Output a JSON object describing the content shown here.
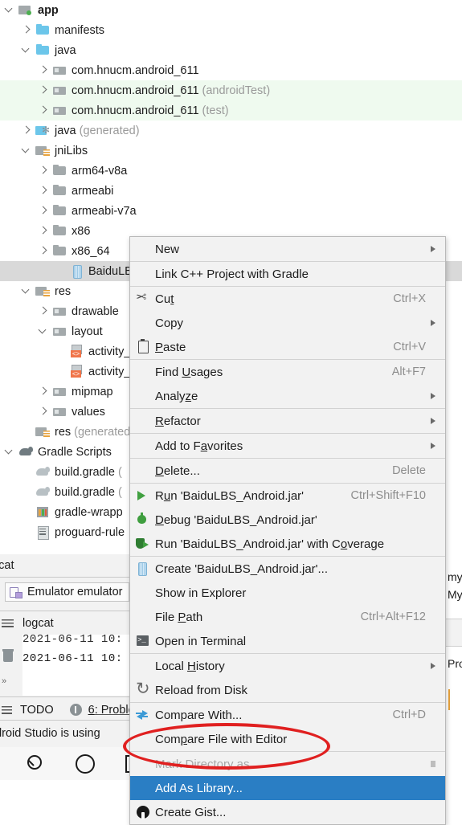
{
  "project_tree": {
    "rows": [
      {
        "indent": 0,
        "twisty": "down",
        "icon": "module-icon",
        "label": "app",
        "dim": "",
        "bold": true,
        "highlight": "none"
      },
      {
        "indent": 1,
        "twisty": "right",
        "icon": "folder-blue-icon",
        "label": "manifests",
        "dim": "",
        "bold": false,
        "highlight": "none"
      },
      {
        "indent": 1,
        "twisty": "down",
        "icon": "folder-blue-icon",
        "label": "java",
        "dim": "",
        "bold": false,
        "highlight": "none"
      },
      {
        "indent": 2,
        "twisty": "right",
        "icon": "package-icon",
        "label": "com.hnucm.android_611",
        "dim": "",
        "bold": false,
        "highlight": "none"
      },
      {
        "indent": 2,
        "twisty": "right",
        "icon": "package-icon",
        "label": "com.hnucm.android_611",
        "dim": "(androidTest)",
        "bold": false,
        "highlight": "green"
      },
      {
        "indent": 2,
        "twisty": "right",
        "icon": "package-icon",
        "label": "com.hnucm.android_611",
        "dim": "(test)",
        "bold": false,
        "highlight": "green"
      },
      {
        "indent": 1,
        "twisty": "right",
        "icon": "generated-java-icon",
        "label": "java",
        "dim": "(generated)",
        "bold": false,
        "highlight": "none"
      },
      {
        "indent": 1,
        "twisty": "down",
        "icon": "res-folder-icon",
        "label": "jniLibs",
        "dim": "",
        "bold": false,
        "highlight": "none"
      },
      {
        "indent": 2,
        "twisty": "right",
        "icon": "folder-gray-icon",
        "label": "arm64-v8a",
        "dim": "",
        "bold": false,
        "highlight": "none"
      },
      {
        "indent": 2,
        "twisty": "right",
        "icon": "folder-gray-icon",
        "label": "armeabi",
        "dim": "",
        "bold": false,
        "highlight": "none"
      },
      {
        "indent": 2,
        "twisty": "right",
        "icon": "folder-gray-icon",
        "label": "armeabi-v7a",
        "dim": "",
        "bold": false,
        "highlight": "none"
      },
      {
        "indent": 2,
        "twisty": "right",
        "icon": "folder-gray-icon",
        "label": "x86",
        "dim": "",
        "bold": false,
        "highlight": "none"
      },
      {
        "indent": 2,
        "twisty": "right",
        "icon": "folder-gray-icon",
        "label": "x86_64",
        "dim": "",
        "bold": false,
        "highlight": "none"
      },
      {
        "indent": 3,
        "twisty": "none",
        "icon": "jar-file-icon",
        "label": "BaiduLBS_A",
        "dim": "",
        "bold": false,
        "highlight": "selected"
      },
      {
        "indent": 1,
        "twisty": "down",
        "icon": "res-folder-icon",
        "label": "res",
        "dim": "",
        "bold": false,
        "highlight": "none"
      },
      {
        "indent": 2,
        "twisty": "right",
        "icon": "package-icon",
        "label": "drawable",
        "dim": "",
        "bold": false,
        "highlight": "none"
      },
      {
        "indent": 2,
        "twisty": "down",
        "icon": "package-icon",
        "label": "layout",
        "dim": "",
        "bold": false,
        "highlight": "none"
      },
      {
        "indent": 3,
        "twisty": "none",
        "icon": "layout-xml-icon",
        "label": "activity_",
        "dim": "",
        "bold": false,
        "highlight": "none"
      },
      {
        "indent": 3,
        "twisty": "none",
        "icon": "layout-xml-icon",
        "label": "activity_",
        "dim": "",
        "bold": false,
        "highlight": "none"
      },
      {
        "indent": 2,
        "twisty": "right",
        "icon": "package-icon",
        "label": "mipmap",
        "dim": "",
        "bold": false,
        "highlight": "none"
      },
      {
        "indent": 2,
        "twisty": "right",
        "icon": "package-icon",
        "label": "values",
        "dim": "",
        "bold": false,
        "highlight": "none"
      },
      {
        "indent": 1,
        "twisty": "none",
        "icon": "res-folder-icon",
        "label": "res",
        "dim": "(generated",
        "bold": false,
        "highlight": "none"
      },
      {
        "indent": 0,
        "twisty": "down",
        "icon": "gradle-icon",
        "label": "Gradle Scripts",
        "dim": "",
        "bold": false,
        "highlight": "none"
      },
      {
        "indent": 1,
        "twisty": "none",
        "icon": "gradle-light-icon",
        "label": "build.gradle",
        "dim": "(",
        "bold": false,
        "highlight": "none"
      },
      {
        "indent": 1,
        "twisty": "none",
        "icon": "gradle-light-icon",
        "label": "build.gradle",
        "dim": "(",
        "bold": false,
        "highlight": "none"
      },
      {
        "indent": 1,
        "twisty": "none",
        "icon": "properties-icon",
        "label": "gradle-wrapp",
        "dim": "",
        "bold": false,
        "highlight": "none"
      },
      {
        "indent": 1,
        "twisty": "none",
        "icon": "doc-file-icon",
        "label": "proguard-rule",
        "dim": "",
        "bold": false,
        "highlight": "none"
      }
    ]
  },
  "bottom": {
    "logcat_tab_label": "ogcat",
    "device_chip_label": "Emulator emulator",
    "logcat_sub_label": "logcat",
    "console_lines": [
      "2021-06-11 10:",
      "2021-06-11 10:"
    ],
    "gutter_chevrons": "»",
    "todo_label": "TODO",
    "problems_number": "6",
    "problems_label": ": Problem",
    "hint_text": "ndroid Studio is using"
  },
  "right_sliver": {
    "line1": "my",
    "line2": "My",
    "line3": "Pro"
  },
  "context_menu": {
    "items": [
      {
        "type": "item",
        "label": "New",
        "accel": "",
        "icon": "",
        "arrow": true,
        "state": "normal",
        "underline_index": -1
      },
      {
        "type": "separator"
      },
      {
        "type": "item",
        "label": "Link C++ Project with Gradle",
        "accel": "",
        "icon": "",
        "arrow": false,
        "state": "normal",
        "underline_index": -1
      },
      {
        "type": "separator"
      },
      {
        "type": "item",
        "label": "Cut",
        "accel": "Ctrl+X",
        "icon": "cut-icon",
        "arrow": false,
        "state": "normal",
        "underline_index": 2
      },
      {
        "type": "item",
        "label": "Copy",
        "accel": "",
        "icon": "",
        "arrow": true,
        "state": "normal",
        "underline_index": -1
      },
      {
        "type": "item",
        "label": "Paste",
        "accel": "Ctrl+V",
        "icon": "paste-icon",
        "arrow": false,
        "state": "normal",
        "underline_index": 0
      },
      {
        "type": "separator"
      },
      {
        "type": "item",
        "label": "Find Usages",
        "accel": "Alt+F7",
        "icon": "",
        "arrow": false,
        "state": "normal",
        "underline_index": 5
      },
      {
        "type": "item",
        "label": "Analyze",
        "accel": "",
        "icon": "",
        "arrow": true,
        "state": "normal",
        "underline_index": 5
      },
      {
        "type": "separator"
      },
      {
        "type": "item",
        "label": "Refactor",
        "accel": "",
        "icon": "",
        "arrow": true,
        "state": "normal",
        "underline_index": 0
      },
      {
        "type": "separator"
      },
      {
        "type": "item",
        "label": "Add to Favorites",
        "accel": "",
        "icon": "",
        "arrow": true,
        "state": "normal",
        "underline_index": 8
      },
      {
        "type": "separator"
      },
      {
        "type": "item",
        "label": "Delete...",
        "accel": "Delete",
        "icon": "",
        "arrow": false,
        "state": "normal",
        "underline_index": 0
      },
      {
        "type": "separator"
      },
      {
        "type": "item",
        "label": "Run 'BaiduLBS_Android.jar'",
        "accel": "Ctrl+Shift+F10",
        "icon": "run-icon",
        "arrow": false,
        "state": "normal",
        "underline_index": 1
      },
      {
        "type": "item",
        "label": "Debug 'BaiduLBS_Android.jar'",
        "accel": "",
        "icon": "debug-icon",
        "arrow": false,
        "state": "normal",
        "underline_index": 0
      },
      {
        "type": "item",
        "label": "Run 'BaiduLBS_Android.jar' with Coverage",
        "accel": "",
        "icon": "coverage-icon",
        "arrow": false,
        "state": "normal",
        "underline_index": 33
      },
      {
        "type": "separator"
      },
      {
        "type": "item",
        "label": "Create 'BaiduLBS_Android.jar'...",
        "accel": "",
        "icon": "jar-icon",
        "arrow": false,
        "state": "normal",
        "underline_index": -1
      },
      {
        "type": "item",
        "label": "Show in Explorer",
        "accel": "",
        "icon": "",
        "arrow": false,
        "state": "normal",
        "underline_index": -1
      },
      {
        "type": "item",
        "label": "File Path",
        "accel": "Ctrl+Alt+F12",
        "icon": "",
        "arrow": false,
        "state": "normal",
        "underline_index": 5
      },
      {
        "type": "item",
        "label": "Open in Terminal",
        "accel": "",
        "icon": "terminal-icon",
        "arrow": false,
        "state": "normal",
        "underline_index": -1
      },
      {
        "type": "separator"
      },
      {
        "type": "item",
        "label": "Local History",
        "accel": "",
        "icon": "",
        "arrow": true,
        "state": "normal",
        "underline_index": 6
      },
      {
        "type": "item",
        "label": "Reload from Disk",
        "accel": "",
        "icon": "reload-icon",
        "arrow": false,
        "state": "normal",
        "underline_index": -1
      },
      {
        "type": "separator"
      },
      {
        "type": "item",
        "label": "Compare With...",
        "accel": "Ctrl+D",
        "icon": "compare-icon",
        "arrow": false,
        "state": "normal",
        "underline_index": -1
      },
      {
        "type": "item",
        "label": "Compare File with Editor",
        "accel": "",
        "icon": "",
        "arrow": false,
        "state": "normal",
        "underline_index": 3
      },
      {
        "type": "separator"
      },
      {
        "type": "item",
        "label": "Mark Directory as",
        "accel": "",
        "icon": "",
        "arrow": true,
        "state": "disabled",
        "underline_index": -1
      },
      {
        "type": "item",
        "label": "Add As Library...",
        "accel": "",
        "icon": "",
        "arrow": false,
        "state": "selected",
        "underline_index": -1
      },
      {
        "type": "item",
        "label": "Create Gist...",
        "accel": "",
        "icon": "github-icon",
        "arrow": false,
        "state": "normal",
        "underline_index": -1
      }
    ]
  },
  "taskbar": {
    "search_icon": "search-icon",
    "task-view_icon": "task-view-icon",
    "explorer_icon": "file-explorer-icon"
  },
  "colors": {
    "menu_background": "#f2f2f2",
    "menu_selected": "#2a7ec4",
    "tree_green_highlight": "#effaef",
    "tree_selection": "#d9d9d9",
    "annotation_red": "#e02020",
    "accent_orange": "#e8a33d"
  }
}
